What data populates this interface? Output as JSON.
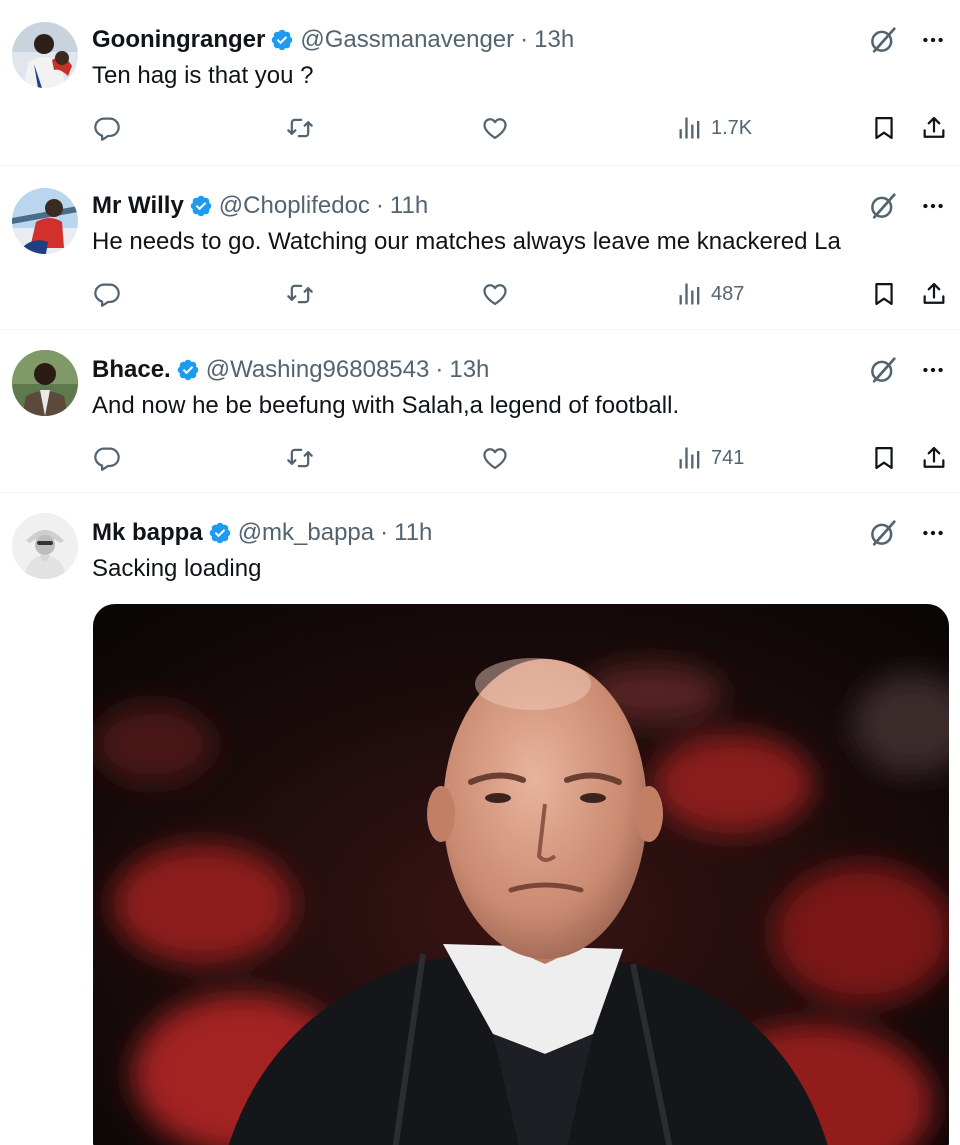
{
  "colors": {
    "verified": "#1d9bf0",
    "secondary_text": "#536471",
    "divider": "#eff3f4"
  },
  "icons": {
    "reply": "reply-icon",
    "retweet": "retweet-icon",
    "like": "heart-icon",
    "views": "views-icon",
    "bookmark": "bookmark-icon",
    "share": "share-icon",
    "grok": "grok-icon",
    "more": "more-icon",
    "verified": "verified-badge-icon"
  },
  "tweets": [
    {
      "name": "Gooningranger",
      "handle": "@Gassmanavenger",
      "separator": "·",
      "time": "13h",
      "text": "Ten hag is that you ?",
      "views": "1.7K"
    },
    {
      "name": "Mr Willy",
      "handle": "@Choplifedoc",
      "separator": "·",
      "time": "11h",
      "text": "He needs to go. Watching our matches always leave me knackered La",
      "views": "487"
    },
    {
      "name": "Bhace.",
      "handle": "@Washing96808543",
      "separator": "·",
      "time": "13h",
      "text": "And now he be beefung with Salah,a legend of football.",
      "views": "741"
    },
    {
      "name": "Mk bappa",
      "handle": "@mk_bappa",
      "separator": "·",
      "time": "11h",
      "text": "Sacking loading"
    }
  ]
}
